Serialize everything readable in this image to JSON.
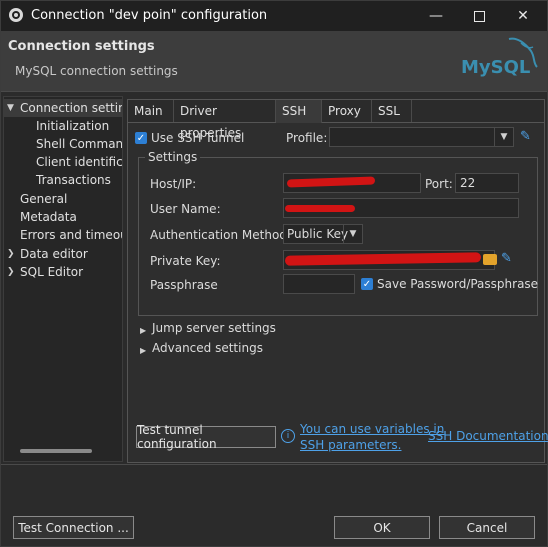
{
  "window": {
    "title": "Connection \"dev poin\" configuration",
    "minimize_icon": "minimize-icon",
    "maximize_icon": "maximize-icon",
    "close_icon": "close-icon"
  },
  "header": {
    "title": "Connection settings",
    "subtitle": "MySQL connection settings",
    "logo_text": "MySQL"
  },
  "tree": {
    "items": [
      {
        "label": "Connection setting",
        "expanded": true,
        "selected": true
      },
      {
        "label": "Initialization"
      },
      {
        "label": "Shell Command"
      },
      {
        "label": "Client identifica"
      },
      {
        "label": "Transactions"
      },
      {
        "label": "General"
      },
      {
        "label": "Metadata"
      },
      {
        "label": "Errors and timeout"
      },
      {
        "label": "Data editor",
        "expandable": true
      },
      {
        "label": "SQL Editor",
        "expandable": true
      }
    ]
  },
  "tabs": [
    {
      "label": "Main"
    },
    {
      "label": "Driver properties"
    },
    {
      "label": "SSH",
      "active": true
    },
    {
      "label": "Proxy"
    },
    {
      "label": "SSL"
    }
  ],
  "ssh": {
    "use_tunnel_label": "Use SSH Tunnel",
    "use_tunnel_checked": true,
    "profile_label": "Profile:",
    "profile_value": "",
    "settings_group_label": "Settings",
    "host_label": "Host/IP:",
    "host_value": "",
    "port_label": "Port:",
    "port_value": "22",
    "username_label": "User Name:",
    "username_value": "",
    "auth_label": "Authentication Method:",
    "auth_value": "Public Key",
    "private_key_label": "Private Key:",
    "private_key_value": "",
    "passphrase_label": "Passphrase",
    "passphrase_value": "",
    "save_password_label": "Save Password/Passphrase",
    "save_password_checked": true,
    "jump_server_label": "Jump server settings",
    "advanced_label": "Advanced settings",
    "test_button_label": "Test tunnel configuration",
    "variables_link_line1": "You can use variables in",
    "variables_link_line2": "SSH parameters.",
    "docs_link_label": "SSH Documentation"
  },
  "footer": {
    "test_connection_label": "Test Connection ...",
    "ok_label": "OK",
    "cancel_label": "Cancel"
  },
  "colors": {
    "accent": "#2d7fd4",
    "link": "#4ea1e8",
    "redaction": "#d21414"
  }
}
